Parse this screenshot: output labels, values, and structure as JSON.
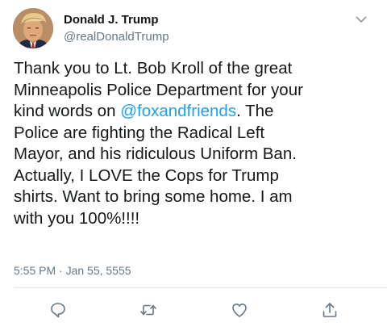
{
  "author": {
    "display_name": "Donald J. Trump",
    "handle": "@realDonaldTrump",
    "avatar_icon": "avatar-photo"
  },
  "tweet": {
    "text_before": "Thank you to Lt. Bob Kroll of the great\nMinneapolis Police Department for your\nkind words on ",
    "mention": "@foxandfriends",
    "text_after": ". The\nPolice are fighting the Radical Left\nMayor, and his ridiculous Uniform Ban.\nActually, I LOVE the Cops for Trump\nshirts. Want to bring some home. I am\nwith you 100%!!!!",
    "timestamp": "5:55 PM · Jan 55, 5555"
  },
  "actions": [
    {
      "name": "reply",
      "icon": "reply-icon"
    },
    {
      "name": "retweet",
      "icon": "retweet-icon"
    },
    {
      "name": "like",
      "icon": "heart-icon"
    },
    {
      "name": "share",
      "icon": "share-icon"
    }
  ],
  "colors": {
    "text": "#14171a",
    "secondary": "#657786",
    "link": "#1da1f2",
    "divider": "#e1e8ed"
  }
}
